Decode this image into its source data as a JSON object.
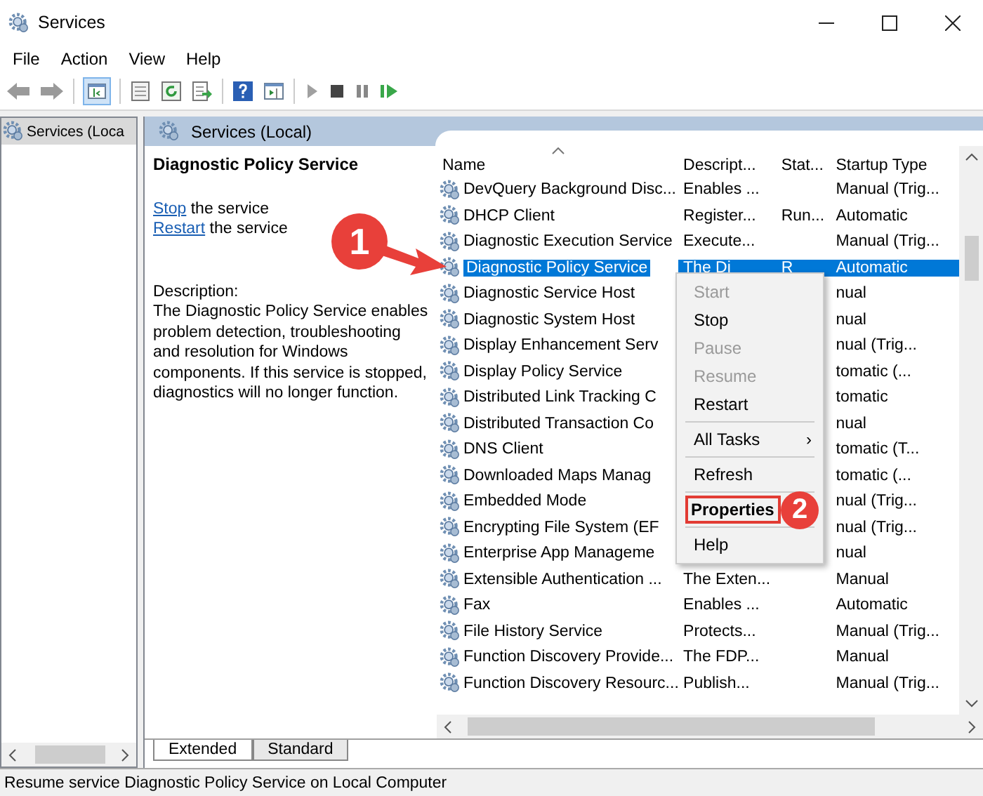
{
  "window": {
    "title": "Services"
  },
  "menu": [
    "File",
    "Action",
    "View",
    "Help"
  ],
  "tree": {
    "items": [
      {
        "label": "Services (Loca",
        "selected": true
      }
    ]
  },
  "pane_header": "Services (Local)",
  "details": {
    "title": "Diagnostic Policy Service",
    "actions": [
      {
        "link": "Stop",
        "text": " the service"
      },
      {
        "link": "Restart",
        "text": " the service"
      }
    ],
    "description_label": "Description:",
    "description": "The Diagnostic Policy Service enables problem detection, troubleshooting and resolution for Windows components.  If this service is stopped, diagnostics will no longer function."
  },
  "table": {
    "columns": [
      "Name",
      "Descript...",
      "Stat...",
      "Startup Type"
    ],
    "rows": [
      {
        "name": "DevQuery Background Disc...",
        "description": "Enables ...",
        "status": "",
        "startup": "Manual (Trig...",
        "selected": false
      },
      {
        "name": "DHCP Client",
        "description": "Register...",
        "status": "Run...",
        "startup": "Automatic",
        "selected": false
      },
      {
        "name": "Diagnostic Execution Service",
        "description": "Execute...",
        "status": "",
        "startup": "Manual (Trig...",
        "selected": false
      },
      {
        "name": "Diagnostic Policy Service",
        "description": "The Di",
        "status": "R",
        "startup": "Automatic",
        "selected": true
      },
      {
        "name": "Diagnostic Service Host",
        "description": "",
        "status": "",
        "startup": "nual",
        "selected": false
      },
      {
        "name": "Diagnostic System Host",
        "description": "",
        "status": "",
        "startup": "nual",
        "selected": false
      },
      {
        "name": "Display Enhancement Serv",
        "description": "",
        "status": "",
        "startup": "nual (Trig...",
        "selected": false
      },
      {
        "name": "Display Policy Service",
        "description": "",
        "status": "",
        "startup": "tomatic (...",
        "selected": false
      },
      {
        "name": "Distributed Link Tracking C",
        "description": "",
        "status": "",
        "startup": "tomatic",
        "selected": false
      },
      {
        "name": "Distributed Transaction Co",
        "description": "",
        "status": "",
        "startup": "nual",
        "selected": false
      },
      {
        "name": "DNS Client",
        "description": "",
        "status": "",
        "startup": "tomatic (T...",
        "selected": false
      },
      {
        "name": "Downloaded Maps Manag",
        "description": "",
        "status": "",
        "startup": "tomatic (...",
        "selected": false
      },
      {
        "name": "Embedded Mode",
        "description": "",
        "status": "",
        "startup": "nual (Trig...",
        "selected": false
      },
      {
        "name": "Encrypting File System (EF",
        "description": "",
        "status": "",
        "startup": "nual (Trig...",
        "selected": false
      },
      {
        "name": "Enterprise App Manageme",
        "description": "",
        "status": "",
        "startup": "nual",
        "selected": false
      },
      {
        "name": "Extensible Authentication ...",
        "description": "The Exten...",
        "status": "",
        "startup": "Manual",
        "selected": false
      },
      {
        "name": "Fax",
        "description": "Enables ...",
        "status": "",
        "startup": "Automatic",
        "selected": false
      },
      {
        "name": "File History Service",
        "description": "Protects...",
        "status": "",
        "startup": "Manual (Trig...",
        "selected": false
      },
      {
        "name": "Function Discovery Provide...",
        "description": "The FDP...",
        "status": "",
        "startup": "Manual",
        "selected": false
      },
      {
        "name": "Function Discovery Resourc...",
        "description": "Publish...",
        "status": "",
        "startup": "Manual (Trig...",
        "selected": false
      }
    ]
  },
  "context_menu": [
    {
      "kind": "item",
      "label": "Start",
      "disabled": true
    },
    {
      "kind": "item",
      "label": "Stop",
      "disabled": false
    },
    {
      "kind": "item",
      "label": "Pause",
      "disabled": true
    },
    {
      "kind": "item",
      "label": "Resume",
      "disabled": true
    },
    {
      "kind": "item",
      "label": "Restart",
      "disabled": false
    },
    {
      "kind": "separator"
    },
    {
      "kind": "submenu",
      "label": "All Tasks",
      "arrow": "›"
    },
    {
      "kind": "separator"
    },
    {
      "kind": "item",
      "label": "Refresh",
      "disabled": false
    },
    {
      "kind": "separator"
    },
    {
      "kind": "item",
      "label": "Properties",
      "disabled": false,
      "default": true,
      "highlighted": true
    },
    {
      "kind": "separator"
    },
    {
      "kind": "item",
      "label": "Help",
      "disabled": false
    }
  ],
  "callouts": [
    "1",
    "2"
  ],
  "view_tabs": [
    {
      "label": "Extended",
      "selected": true
    },
    {
      "label": "Standard",
      "selected": false
    }
  ],
  "status_bar": "Resume service Diagnostic Policy Service on Local Computer"
}
